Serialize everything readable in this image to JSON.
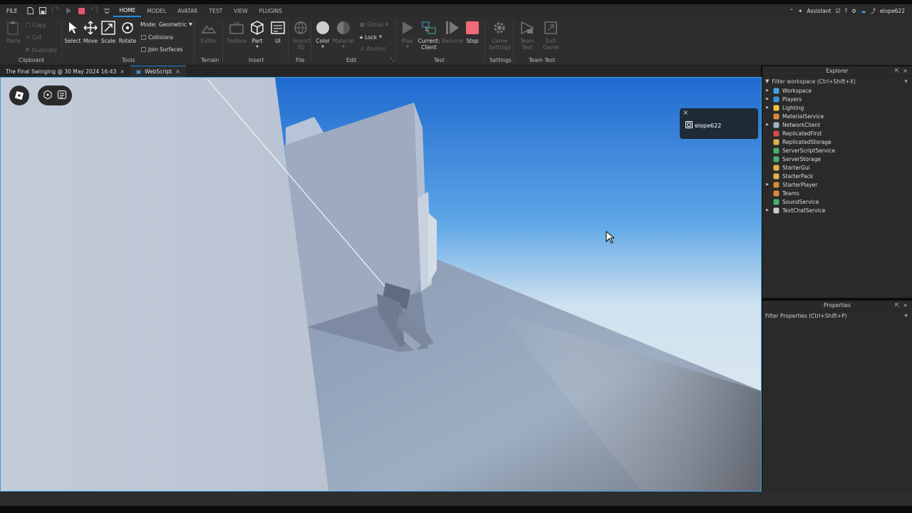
{
  "topbar": {
    "file_label": "FILE",
    "tabs": [
      {
        "label": "HOME",
        "active": true
      },
      {
        "label": "MODEL",
        "active": false
      },
      {
        "label": "AVATAR",
        "active": false
      },
      {
        "label": "TEST",
        "active": false
      },
      {
        "label": "VIEW",
        "active": false
      },
      {
        "label": "PLUGINS",
        "active": false
      }
    ],
    "assistant_label": "Assistant",
    "username": "elope622"
  },
  "ribbon": {
    "clipboard": {
      "paste": "Paste",
      "copy": "Copy",
      "cut": "Cut",
      "duplicate": "Duplicate",
      "group_label": "Clipboard"
    },
    "tools": {
      "select": "Select",
      "move": "Move",
      "scale": "Scale",
      "rotate": "Rotate",
      "mode_label": "Mode:",
      "mode_value": "Geometric",
      "collisions": "Collisions",
      "join_surfaces": "Join Surfaces",
      "group_label": "Tools"
    },
    "terrain": {
      "editor": "Editor",
      "group_label": "Terrain"
    },
    "insert": {
      "toolbox": "Toolbox",
      "part": "Part",
      "ui": "UI",
      "group_label": "Insert"
    },
    "file": {
      "import_3d": "Import 3D",
      "group_label": "File"
    },
    "edit": {
      "color": "Color",
      "material": "Material",
      "group": "Group",
      "lock": "Lock",
      "anchor": "Anchor",
      "group_label": "Edit"
    },
    "test": {
      "play": "Play",
      "current_client": "Current: Client",
      "resume": "Resume",
      "stop": "Stop",
      "group_label": "Test"
    },
    "settings": {
      "game_settings": "Game Settings",
      "group_label": "Settings"
    },
    "team_test": {
      "team_test": "Team Test",
      "exit_game": "Exit Game",
      "group_label": "Team Test"
    }
  },
  "doc_tabs": [
    {
      "label": "The Final Swinging @ 30 May 2024 16:43"
    },
    {
      "label": "WebScript"
    }
  ],
  "toast": {
    "username": "elope622"
  },
  "explorer": {
    "title": "Explorer",
    "filter_placeholder": "Filter workspace (Ctrl+Shift+X)",
    "items": [
      {
        "label": "Workspace",
        "expandable": true,
        "icon": "globe-icon",
        "color": "#4a9fe0"
      },
      {
        "label": "Players",
        "expandable": true,
        "icon": "players-icon",
        "color": "#3d8fe0"
      },
      {
        "label": "Lighting",
        "expandable": true,
        "icon": "lightbulb-icon",
        "color": "#f5c542"
      },
      {
        "label": "MaterialService",
        "expandable": false,
        "icon": "material-icon",
        "color": "#d88a3a"
      },
      {
        "label": "NetworkClient",
        "expandable": true,
        "icon": "network-icon",
        "color": "#9fb7c9"
      },
      {
        "label": "ReplicatedFirst",
        "expandable": false,
        "icon": "folder-icon",
        "color": "#d94c4c"
      },
      {
        "label": "ReplicatedStorage",
        "expandable": false,
        "icon": "folder-icon",
        "color": "#e2b24a"
      },
      {
        "label": "ServerScriptService",
        "expandable": false,
        "icon": "script-service-icon",
        "color": "#49b06b"
      },
      {
        "label": "ServerStorage",
        "expandable": false,
        "icon": "storage-icon",
        "color": "#49b06b"
      },
      {
        "label": "StarterGui",
        "expandable": false,
        "icon": "gui-icon",
        "color": "#e2b24a"
      },
      {
        "label": "StarterPack",
        "expandable": false,
        "icon": "pack-icon",
        "color": "#e2b24a"
      },
      {
        "label": "StarterPlayer",
        "expandable": true,
        "icon": "player-icon",
        "color": "#d88a3a"
      },
      {
        "label": "Teams",
        "expandable": false,
        "icon": "teams-icon",
        "color": "#d88a3a"
      },
      {
        "label": "SoundService",
        "expandable": false,
        "icon": "sound-icon",
        "color": "#49b06b"
      },
      {
        "label": "TextChatService",
        "expandable": true,
        "icon": "chat-icon",
        "color": "#ccc"
      }
    ]
  },
  "properties": {
    "title": "Properties",
    "filter_placeholder": "Filter Properties (Ctrl+Shift+P)"
  }
}
